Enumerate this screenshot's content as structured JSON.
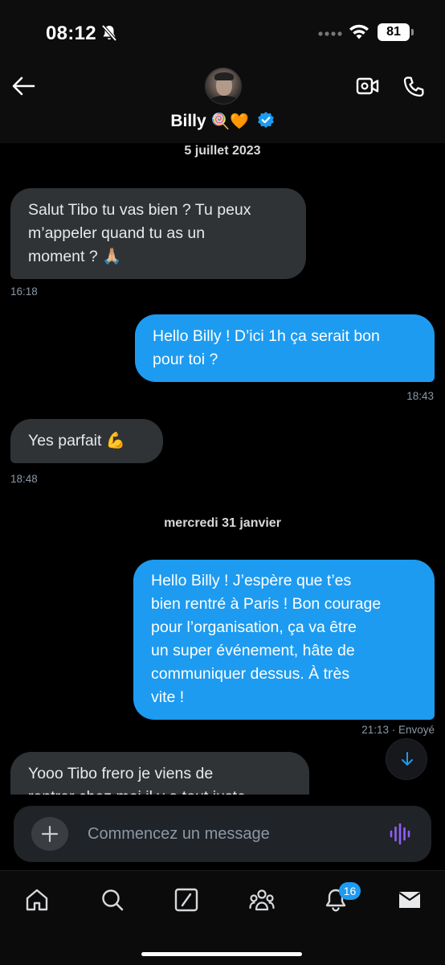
{
  "status": {
    "time": "08:12",
    "battery": "81"
  },
  "header": {
    "name": "Billy",
    "name_emojis": "🍭🧡"
  },
  "messages": [
    {
      "date": "5 juillet 2023"
    },
    {
      "in_1": "Salut Tibo tu vas bien ? Tu peux m’appeler quand tu as un moment ? 🙏🏼",
      "in_1_time": "16:18"
    },
    {
      "out_1": "Hello Billy ! D’ici 1h ça serait bon pour toi ?",
      "out_1_time": "18:43"
    },
    {
      "in_2": "Yes parfait 💪",
      "in_2_time": "18:48"
    }
  ],
  "chat": {
    "date_1": "5 juillet 2023",
    "date_2": "mercredi 31 janvier",
    "in_1_line1": "Salut Tibo tu vas bien ? Tu peux",
    "in_1_line2": "m’appeler quand tu as un",
    "in_1_line3": "moment ? 🙏🏼",
    "in_1_time": "16:18",
    "out_1_line1": "Hello Billy ! D’ici 1h ça serait bon",
    "out_1_line2": "pour toi ?",
    "out_1_time": "18:43",
    "in_2": "Yes parfait 💪",
    "in_2_time": "18:48",
    "out_2_lines": [
      "Hello Billy ! J’espère que t’es",
      "bien rentré à Paris ! Bon courage",
      "pour l’organisation, ça va être",
      "un super événement, hâte de",
      "communiquer dessus. À très",
      "vite !"
    ],
    "out_2_time": "21:13 · Envoyé",
    "in_3_line1": "Yooo Tibo frero je viens de",
    "in_3_line2": "rentrer chez moi il y a tout juste"
  },
  "composer": {
    "placeholder": "Commencez un message"
  },
  "nav": {
    "notifications_badge": "16"
  },
  "colors": {
    "accent": "#1d9bf0",
    "incoming_bubble": "#2f3336",
    "background": "#000000",
    "voice_icon": "#8e60f5"
  }
}
